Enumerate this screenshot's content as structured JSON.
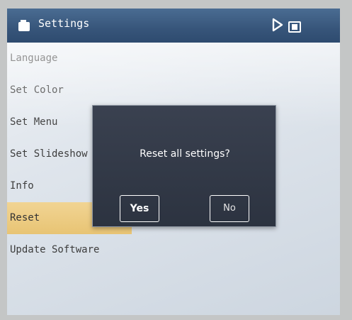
{
  "header": {
    "title": "Settings",
    "icons": [
      "settings-icon",
      "play-icon",
      "card-icon"
    ]
  },
  "menu": {
    "items": [
      {
        "label": "Language",
        "selected": false
      },
      {
        "label": "Set Color",
        "selected": false
      },
      {
        "label": "Set Menu",
        "selected": false
      },
      {
        "label": "Set Slideshow",
        "selected": false
      },
      {
        "label": "Info",
        "selected": false
      },
      {
        "label": "Reset",
        "selected": true
      },
      {
        "label": "Update Software",
        "selected": false
      }
    ]
  },
  "dialog": {
    "message": "Reset all settings?",
    "yes_label": "Yes",
    "no_label": "No"
  },
  "colors": {
    "header": "#3a5a80",
    "selected": "#ecc97c",
    "dialog": "#323946"
  }
}
